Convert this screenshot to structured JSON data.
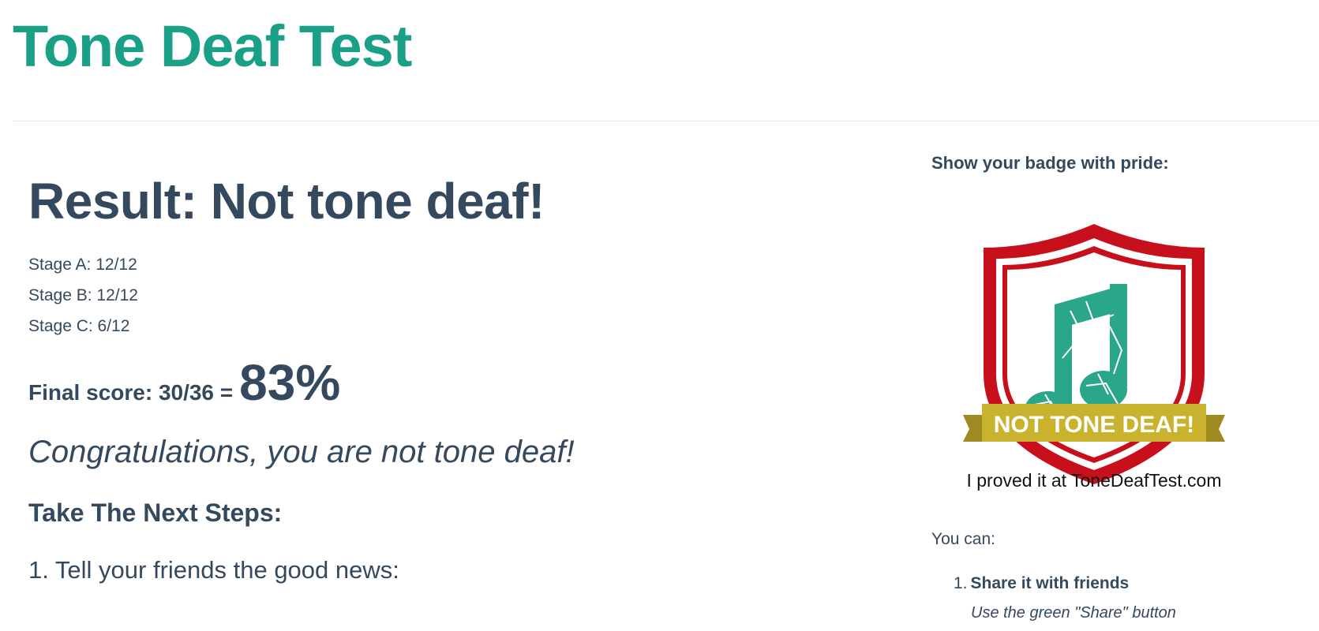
{
  "site": {
    "title": "Tone Deaf Test"
  },
  "result": {
    "title": "Result: Not tone deaf!",
    "stages": [
      {
        "label": "Stage A: 12/12"
      },
      {
        "label": "Stage B: 12/12"
      },
      {
        "label": "Stage C: 6/12"
      }
    ],
    "final_label": "Final score: 30/36 =",
    "final_percent": "83%",
    "congrats": "Congratulations, you are not tone deaf!",
    "next_steps_heading": "Take The Next Steps:",
    "step1": "1. Tell your friends the good news:"
  },
  "sidebar": {
    "badge_heading": "Show your badge with pride:",
    "badge": {
      "ribbon_text": "NOT TONE DEAF!",
      "tagline": "I proved it at ToneDeafTest.com",
      "colors": {
        "shield_red": "#c8101c",
        "note_green": "#2aa68a",
        "ribbon_gold": "#c9b22e"
      }
    },
    "you_can": "You can:",
    "items": [
      {
        "number": "1.",
        "title": "Share it with friends",
        "sub": "Use the green \"Share\" button"
      }
    ]
  }
}
